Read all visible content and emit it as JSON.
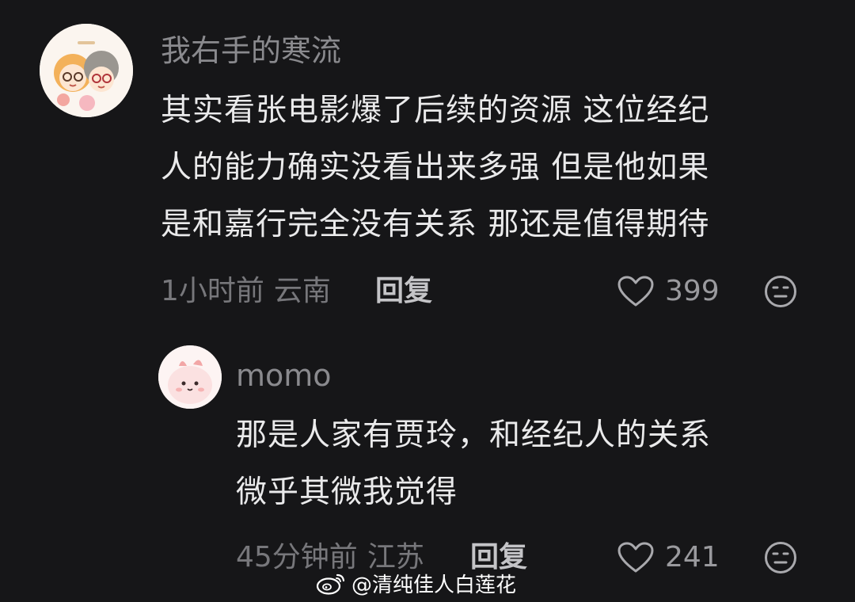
{
  "comments": [
    {
      "username": "我右手的寒流",
      "avatar": "couple-cartoon-avatar",
      "content_lines": [
        "其实看张电影爆了后续的资源 这位经纪",
        "人的能力确实没看出来多强 但是他如果",
        "是和嘉行完全没有关系 那还是值得期待"
      ],
      "time": "1小时前",
      "location": "云南",
      "reply_label": "回复",
      "likes": "399"
    }
  ],
  "replies": [
    {
      "username": "momo",
      "avatar": "pink-bunny-avatar",
      "content_lines": [
        "那是人家有贾玲，和经纪人的关系",
        "微乎其微我觉得"
      ],
      "time": "45分钟前",
      "location": "江苏",
      "reply_label": "回复",
      "likes": "241"
    }
  ],
  "watermark": {
    "text": "@清纯佳人白莲花",
    "icon": "weibo-logo-icon"
  },
  "colors": {
    "background": "#161618",
    "text": "#eaeaeb",
    "secondary": "#8a8a8e"
  }
}
